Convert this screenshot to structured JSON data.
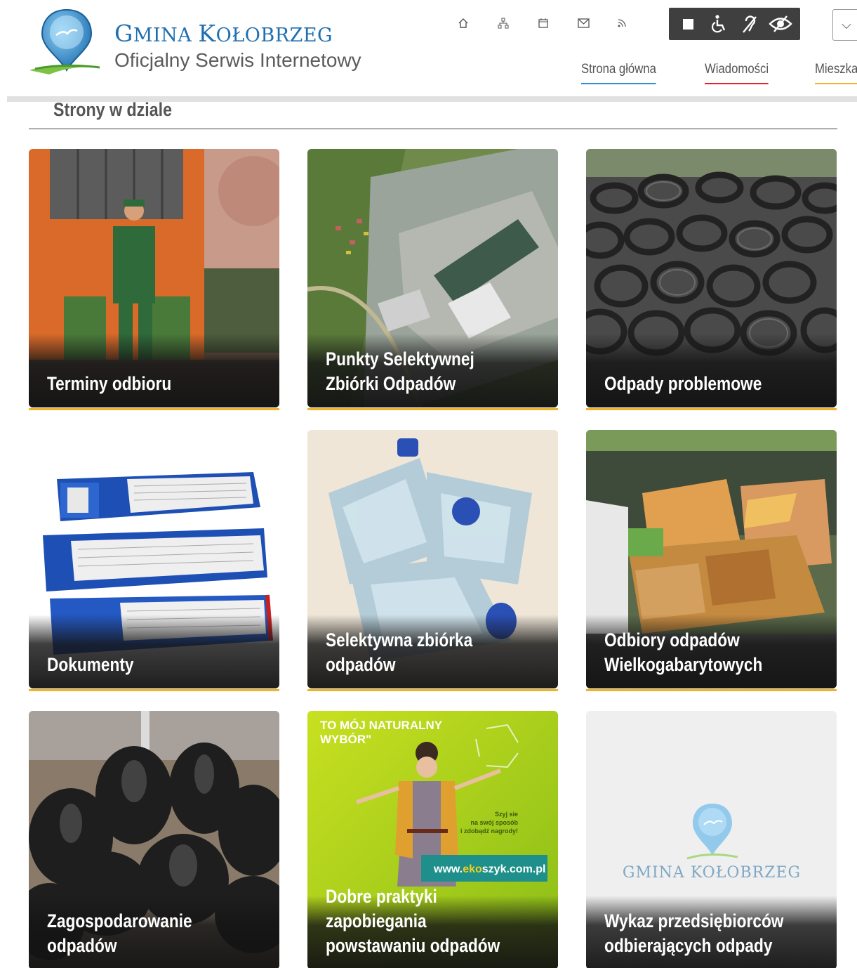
{
  "header": {
    "title_first_cap": "G",
    "title_first_rest": "MINA ",
    "title_second_cap": "K",
    "title_second_rest": "OŁOBRZEG",
    "subtitle": "Oficjalny Serwis Internetowy",
    "top_icons": [
      "home-icon",
      "sitemap-icon",
      "calendar-icon",
      "envelope-icon",
      "rss-icon"
    ],
    "accessibility": [
      "contrast-icon",
      "wheelchair-icon",
      "hearing-icon",
      "eye-icon"
    ],
    "dropdown_glyph": "⌵"
  },
  "nav": {
    "items": [
      {
        "label": "Strona główna",
        "color": "#2f8fd0"
      },
      {
        "label": "Wiadomości",
        "color": "#d9262c"
      },
      {
        "label": "Mieszka",
        "color": "#f0b429"
      }
    ]
  },
  "section": {
    "title": "Strony w dziale"
  },
  "tiles": [
    {
      "label": "Terminy odbioru",
      "image": "garbage-truck-worker"
    },
    {
      "label": "Punkty Selektywnej Zbiórki Odpadów",
      "image": "aerial-collection-site"
    },
    {
      "label": "Odpady problemowe",
      "image": "tire-pile"
    },
    {
      "label": "Dokumenty",
      "image": "binders-stack"
    },
    {
      "label": "Selektywna zbiórka odpadów",
      "image": "plastic-bottles"
    },
    {
      "label": "Odbiory odpadów Wielkogabarytowych",
      "image": "bulky-furniture"
    },
    {
      "label": "Zagospodarowanie odpadów",
      "image": "black-trash-bags"
    },
    {
      "label": "Dobre praktyki zapobiegania powstawaniu odpadów",
      "image": "ekoszyk-poster"
    },
    {
      "label": "Wykaz przedsiębiorców odbierających odpady",
      "image": "gmina-logo-placeholder"
    }
  ],
  "poster": {
    "headline_1": "TO MÓJ NATURALNY",
    "headline_2": "WYBÓR\"",
    "small_1": "Szyj sie",
    "small_2": "na swój sposób",
    "small_3": "i zdobądź nagrody!",
    "url_prefix": "www.",
    "url_eko": "eko",
    "url_suffix": "szyk.com.pl"
  },
  "placeholder_logo": {
    "text": "GMINA KOŁOBRZEG"
  },
  "colors": {
    "accent_blue": "#1f6fb0",
    "tile_underline": "#f0b429",
    "access_bar": "#3f3f3f"
  }
}
